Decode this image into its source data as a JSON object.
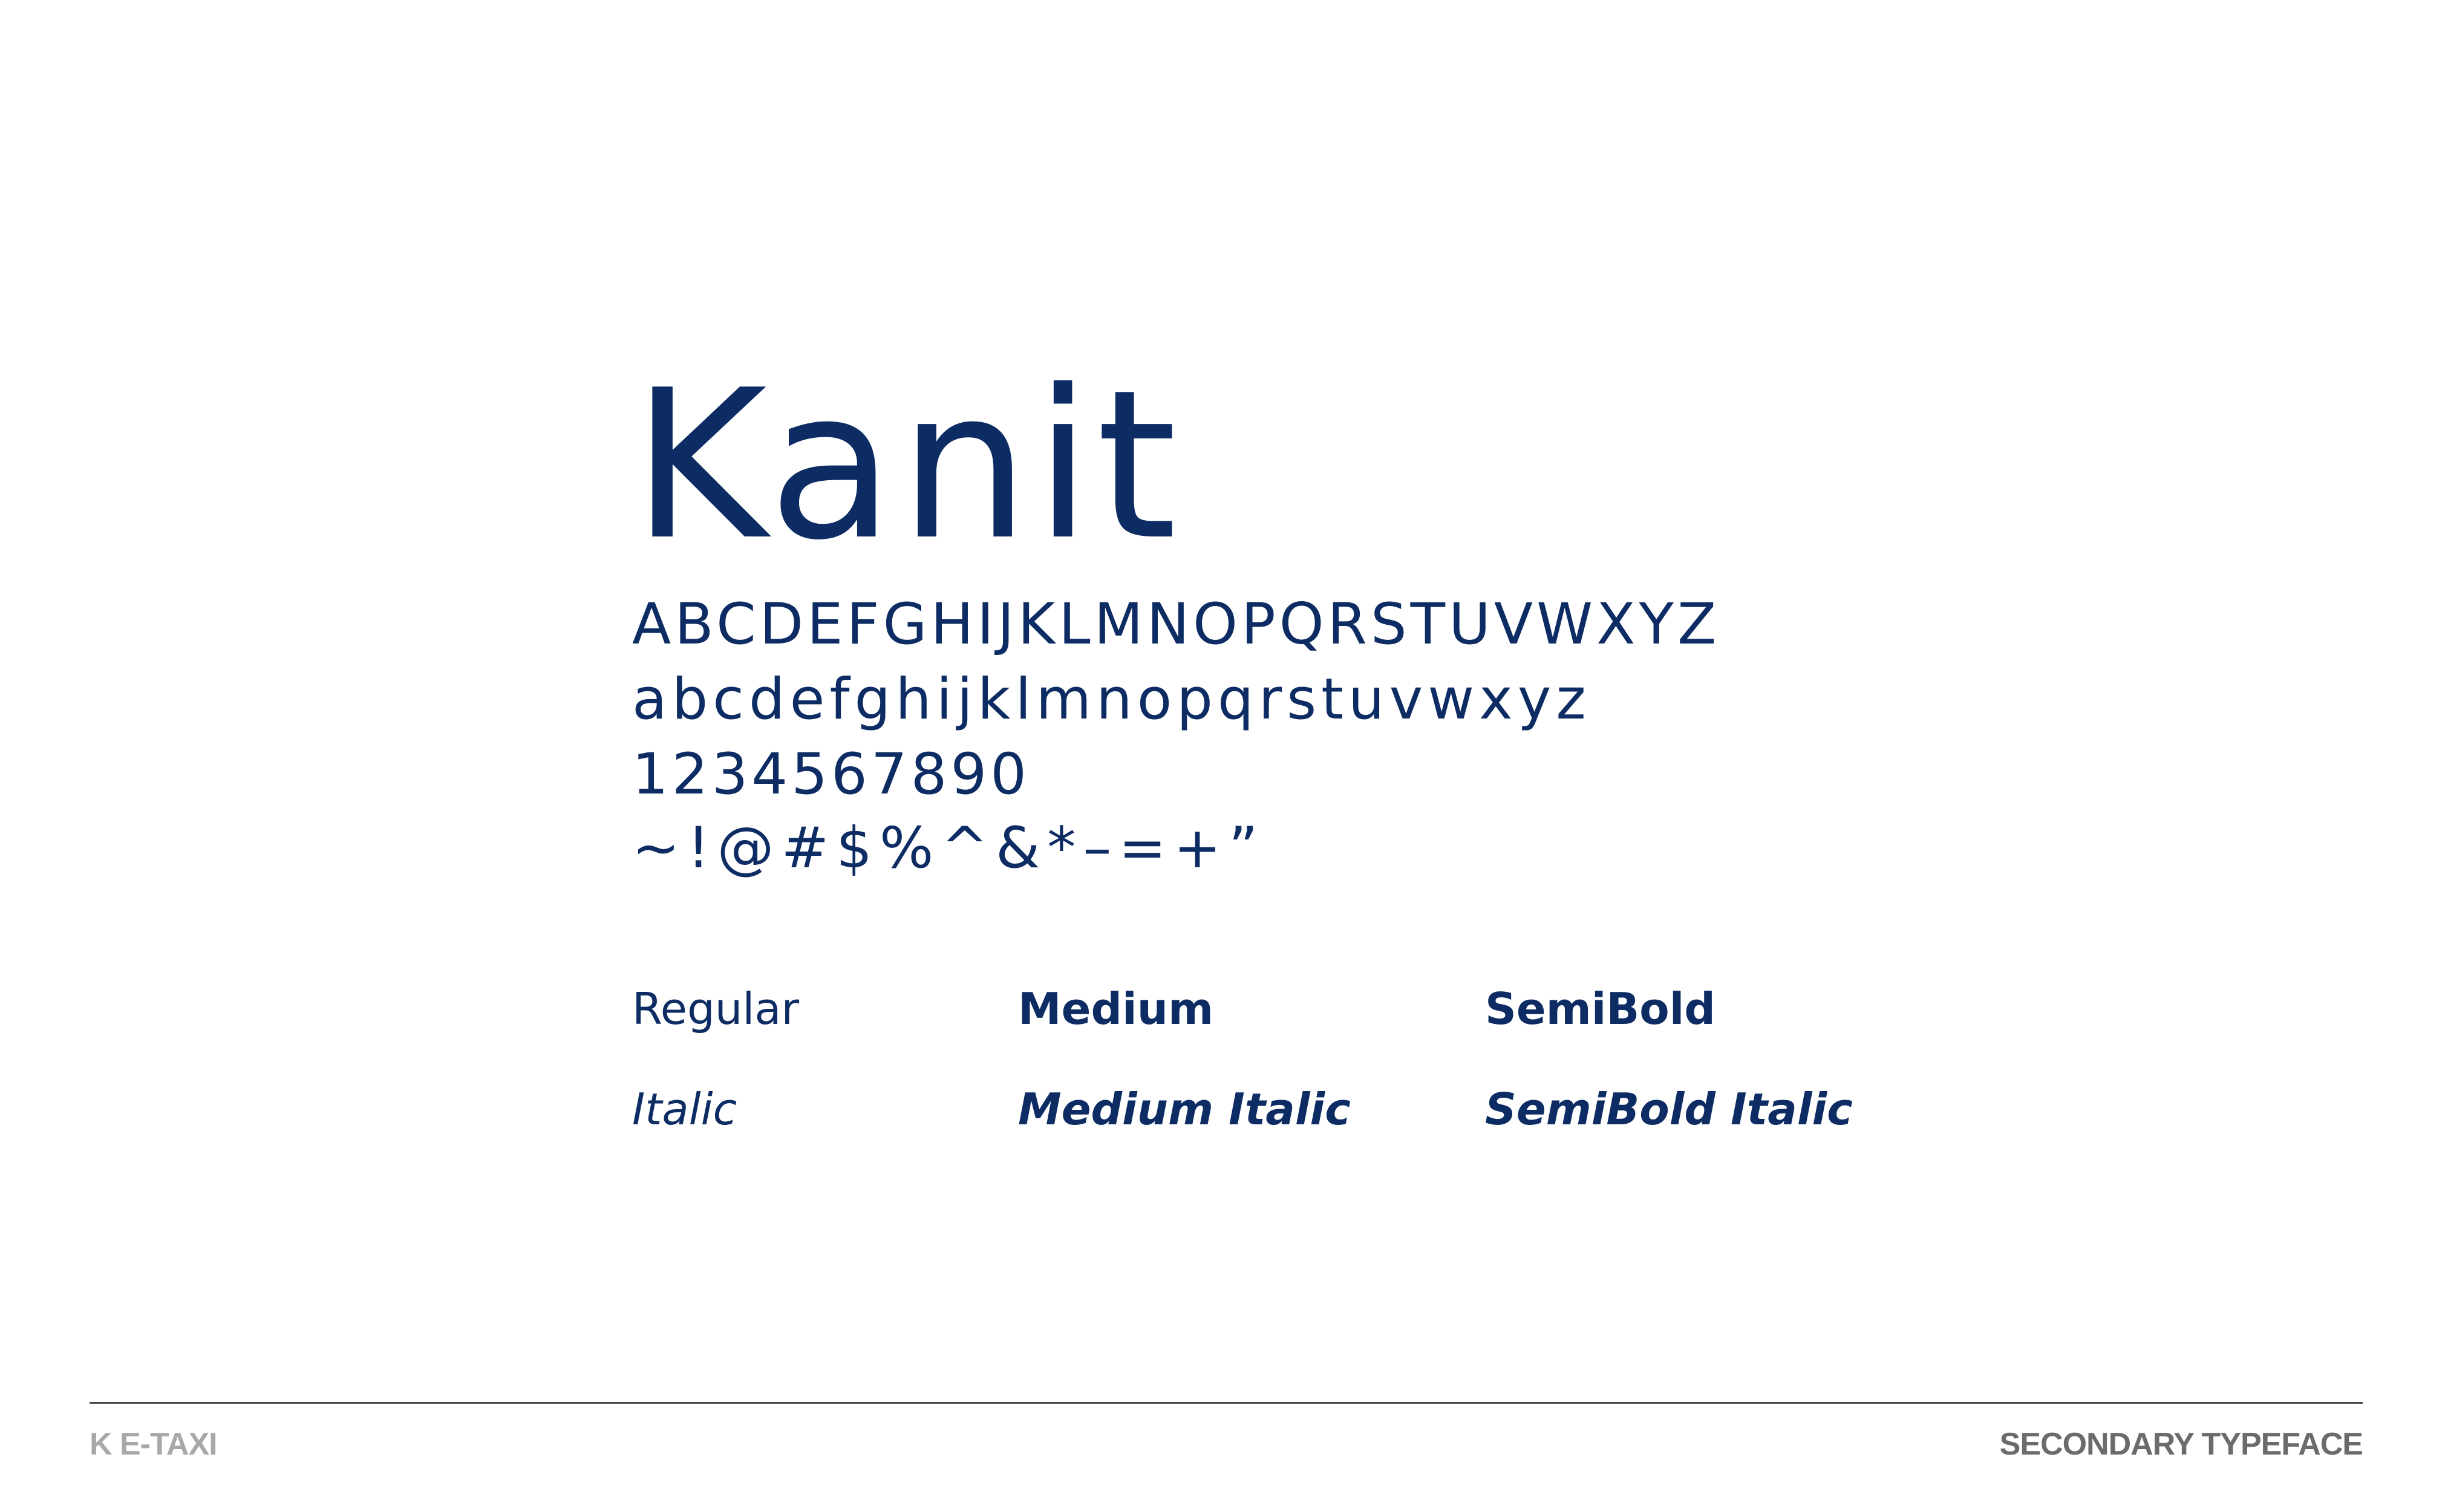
{
  "specimen": {
    "font_name": "Kanit",
    "uppercase": "ABCDEFGHIJKLMNOPQRSTUVWXYZ",
    "lowercase": "abcdefghijklmnopqrstuvwxyz",
    "digits": "1234567890",
    "symbols": "~!@#$%^&*–=+”",
    "weights": {
      "regular": "Regular",
      "medium": "Medium",
      "semibold": "SemiBold",
      "italic": "Italic",
      "medium_italic": "Medium Italic",
      "semibold_italic": "SemiBold Italic"
    }
  },
  "footer": {
    "brand": "K E-TAXI",
    "section": "SECONDARY TYPEFACE"
  },
  "colors": {
    "primary_navy": "#0d2c63",
    "footer_brand_gray": "#a8a8a8",
    "footer_section_gray": "#6b6b6b",
    "rule": "#4a4a4a"
  }
}
